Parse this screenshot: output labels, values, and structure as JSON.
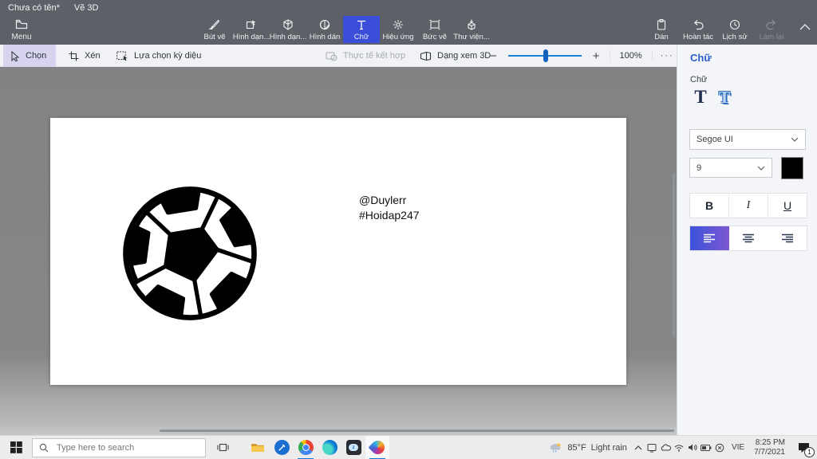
{
  "titlebar": {
    "document": "Chưa có tên*",
    "app": "Vẽ 3D"
  },
  "top_toolbar": {
    "menu_label": "Menu",
    "tools": [
      {
        "label": "Bút vẽ"
      },
      {
        "label": "Hình dạn..."
      },
      {
        "label": "Hình dạn..."
      },
      {
        "label": "Hình dán"
      },
      {
        "label": "Chữ"
      },
      {
        "label": "Hiệu ứng"
      },
      {
        "label": "Bức vẽ"
      },
      {
        "label": "Thư viện..."
      }
    ],
    "selected_tool": "Chữ",
    "right_tools": [
      {
        "label": "Dán"
      },
      {
        "label": "Hoàn tác"
      },
      {
        "label": "Lịch sử"
      },
      {
        "label": "Làm lại"
      }
    ]
  },
  "ribbon": {
    "select_label": "Chọn",
    "crop_label": "Xén",
    "magic_select_label": "Lựa chọn kỳ diệu",
    "mixed_reality_label": "Thực tế kết hợp",
    "view_3d_label": "Dạng xem 3D",
    "zoom_out": "−",
    "zoom_in": "+",
    "zoom_level": "100%",
    "more": "···"
  },
  "panel": {
    "header": "Chữ",
    "section_label": "Chữ",
    "text_2d": "T",
    "text_3d": "T",
    "font_name": "Segoe UI",
    "font_size": "9",
    "bold": "B",
    "italic": "I",
    "underline": "U",
    "text_color": "#000000"
  },
  "canvas": {
    "text_line1": "@Duylerr",
    "text_line2": "#Hoidap247"
  },
  "taskbar": {
    "search_placeholder": "Type here to search",
    "weather_temp": "85°F",
    "weather_cond": "Light rain",
    "language": "VIE",
    "time": "8:25 PM",
    "date": "7/7/2021",
    "notification_count": "1"
  },
  "colors": {
    "accent_selected_tool": "#3b4eda",
    "ribbon_highlight": "#d7d4ef",
    "slider_blue": "#1c7fd6",
    "align_selected_gradient": "#3a54da→#7e57d2",
    "taskbar_underline": "#0a7ad8",
    "panel_header_blue": "#2a5fc8"
  }
}
